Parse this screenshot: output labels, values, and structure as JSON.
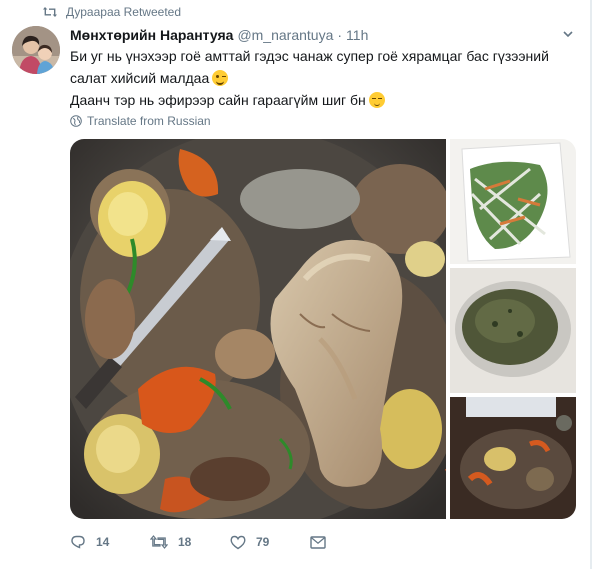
{
  "retweet": {
    "text": "Дурааpaa Retweeted",
    "icon": "retweet-icon"
  },
  "tweet": {
    "author_name": "Мөнхтөрийн Нарантуяа",
    "handle": "@m_narantuya",
    "separator": "·",
    "time": "11h",
    "line1": "Би уг нь үнэхээр гоё амттай гэдэс чанаж супер гоё хярамцаг бас гүзээний",
    "line2": "салат хийсий малдаа",
    "line3": "Даанч тэр нь эфирээр сайн гараагүйм шиг бн",
    "line2_emoji": "winking-face-tongue-emoji",
    "line3_emoji": "sleepy-face-emoji",
    "translate": "Translate from Russian"
  },
  "media": {
    "main_image": "boiled-meat-pot-photo",
    "side_images": [
      "vegetable-salad-photo",
      "green-soup-photo",
      "meal-table-photo"
    ]
  },
  "actions": {
    "reply_count": "14",
    "retweet_count": "18",
    "like_count": "79"
  },
  "colors": {
    "text": "#14171a",
    "secondary": "#657786",
    "border": "#e6ecf0"
  }
}
